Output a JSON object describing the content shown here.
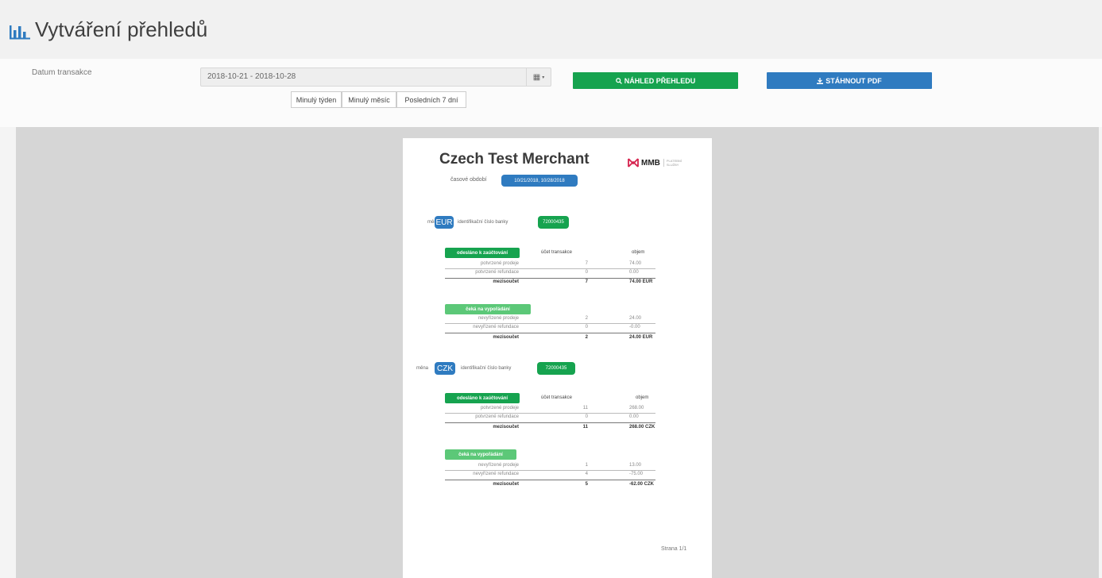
{
  "header": {
    "title": "Vytváření přehledů",
    "icon": "bar-chart-icon"
  },
  "filter": {
    "date_label": "Datum transakce",
    "date_range": "2018-10-21 - 2018-10-28",
    "quick": [
      "Minulý týden",
      "Minulý měsíc",
      "Posledních 7 dní"
    ],
    "preview_button": "NÁHLED PŘEHLEDU",
    "download_button": "STÁHNOUT PDF",
    "colors": {
      "green": "#16a34f",
      "blue": "#2f7bc0"
    }
  },
  "report": {
    "merchant": "Czech Test Merchant",
    "logo": "MMB",
    "logo_sub": "PLATEBNÍ SLUŽBY",
    "period_label": "časové období",
    "period_value": "10/21/2018, 10/28/2018",
    "page": "Strana 1/1",
    "currencies": [
      {
        "currency_label": "měna",
        "currency": "EUR",
        "bank_label": "identifikační číslo banky",
        "bank_id": "72000435",
        "sections": [
          {
            "title": "odesláno k zaúčtování",
            "count_header": "účet transakce",
            "volume_header": "objem",
            "rows": [
              {
                "label": "potvrzené prodeje",
                "count": "7",
                "volume": "74.00"
              },
              {
                "label": "potvrzené refundace",
                "count": "0",
                "volume": "0.00"
              }
            ],
            "subtotal": {
              "label": "mezisoučet",
              "count": "7",
              "volume": "74.00 EUR"
            }
          },
          {
            "title": "čeká na vypořádání",
            "rows": [
              {
                "label": "nevyřízené prodeje",
                "count": "2",
                "volume": "24.00"
              },
              {
                "label": "nevyřízené refundace",
                "count": "0",
                "volume": "-0.00"
              }
            ],
            "subtotal": {
              "label": "mezisoučet",
              "count": "2",
              "volume": "24.00 EUR"
            }
          }
        ]
      },
      {
        "currency_label": "měna",
        "currency": "CZK",
        "bank_label": "identifikační číslo banky",
        "bank_id": "72000435",
        "sections": [
          {
            "title": "odesláno k zaúčtování",
            "count_header": "účet transakce",
            "volume_header": "objem",
            "rows": [
              {
                "label": "potvrzené prodeje",
                "count": "11",
                "volume": "268.00"
              },
              {
                "label": "potvrzené refundace",
                "count": "0",
                "volume": "0.00"
              }
            ],
            "subtotal": {
              "label": "mezisoučet",
              "count": "11",
              "volume": "268.00 CZK"
            }
          },
          {
            "title": "čeká na vypořádání",
            "rows": [
              {
                "label": "nevyřízené prodeje",
                "count": "1",
                "volume": "13.00"
              },
              {
                "label": "nevyřízené refundace",
                "count": "4",
                "volume": "-75.00"
              }
            ],
            "subtotal": {
              "label": "mezisoučet",
              "count": "5",
              "volume": "-62.00 CZK"
            }
          }
        ]
      }
    ]
  }
}
